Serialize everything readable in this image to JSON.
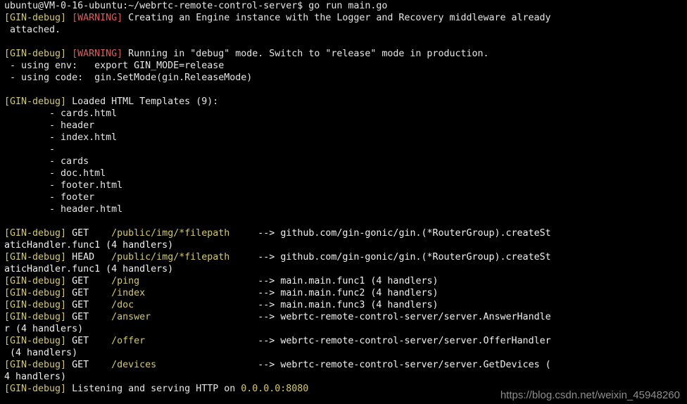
{
  "terminal": {
    "colors": {
      "background": "#000000",
      "foreground": "#e6e6e6",
      "debug_tag": "#d4c96a",
      "warning_tag": "#e05c5c",
      "route_path": "#d4c96a",
      "watermark": "#8e8e8e"
    },
    "prompt": {
      "user_host": "ubuntu@VM-0-16-ubuntu",
      "separator": ":",
      "cwd": "~/webrtc-remote-control-server",
      "symbol": "$",
      "command": "go run main.go",
      "full": "ubuntu@VM-0-16-ubuntu:~/webrtc-remote-control-server$ go run main.go"
    },
    "lines": [
      {
        "id": "prompt-line",
        "segments": [
          {
            "cls": "seg-prompt",
            "text": "ubuntu@VM-0-16-ubuntu:~/webrtc-remote-control-server$ go run main.go"
          }
        ]
      },
      {
        "id": "warn-engine-1",
        "segments": [
          {
            "cls": "seg-debug",
            "text": "[GIN-debug] "
          },
          {
            "cls": "seg-warning",
            "text": "[WARNING] "
          },
          {
            "cls": "seg-plain",
            "text": "Creating an Engine instance with the Logger and Recovery middleware already"
          }
        ]
      },
      {
        "id": "warn-engine-2",
        "segments": [
          {
            "cls": "seg-plain",
            "text": " attached."
          }
        ]
      },
      {
        "id": "spacer-1",
        "segments": [
          {
            "cls": "seg-plain",
            "text": " "
          }
        ]
      },
      {
        "id": "warn-mode-1",
        "segments": [
          {
            "cls": "seg-debug",
            "text": "[GIN-debug] "
          },
          {
            "cls": "seg-warning",
            "text": "[WARNING] "
          },
          {
            "cls": "seg-plain",
            "text": "Running in \"debug\" mode. Switch to \"release\" mode in production."
          }
        ]
      },
      {
        "id": "warn-mode-env",
        "segments": [
          {
            "cls": "seg-plain",
            "text": " - using env:   export GIN_MODE=release"
          }
        ]
      },
      {
        "id": "warn-mode-code",
        "segments": [
          {
            "cls": "seg-plain",
            "text": " - using code:  gin.SetMode(gin.ReleaseMode)"
          }
        ]
      },
      {
        "id": "spacer-2",
        "segments": [
          {
            "cls": "seg-plain",
            "text": " "
          }
        ]
      },
      {
        "id": "templates-header",
        "segments": [
          {
            "cls": "seg-debug",
            "text": "[GIN-debug] "
          },
          {
            "cls": "seg-plain",
            "text": "Loaded HTML Templates (9):"
          }
        ]
      },
      {
        "id": "template-cards-html",
        "segments": [
          {
            "cls": "seg-plain",
            "text": "        - cards.html"
          }
        ]
      },
      {
        "id": "template-header",
        "segments": [
          {
            "cls": "seg-plain",
            "text": "        - header"
          }
        ]
      },
      {
        "id": "template-index-html",
        "segments": [
          {
            "cls": "seg-plain",
            "text": "        - index.html"
          }
        ]
      },
      {
        "id": "template-empty",
        "segments": [
          {
            "cls": "seg-plain",
            "text": "        - "
          }
        ]
      },
      {
        "id": "template-cards",
        "segments": [
          {
            "cls": "seg-plain",
            "text": "        - cards"
          }
        ]
      },
      {
        "id": "template-doc-html",
        "segments": [
          {
            "cls": "seg-plain",
            "text": "        - doc.html"
          }
        ]
      },
      {
        "id": "template-footer-html",
        "segments": [
          {
            "cls": "seg-plain",
            "text": "        - footer.html"
          }
        ]
      },
      {
        "id": "template-footer",
        "segments": [
          {
            "cls": "seg-plain",
            "text": "        - footer"
          }
        ]
      },
      {
        "id": "template-header-html",
        "segments": [
          {
            "cls": "seg-plain",
            "text": "        - header.html"
          }
        ]
      },
      {
        "id": "spacer-3",
        "segments": [
          {
            "cls": "seg-plain",
            "text": " "
          }
        ]
      },
      {
        "id": "route-img-get-1",
        "segments": [
          {
            "cls": "seg-debug",
            "text": "[GIN-debug] "
          },
          {
            "cls": "seg-method",
            "text": "GET "
          },
          {
            "cls": "seg-plain",
            "text": "   "
          },
          {
            "cls": "seg-path",
            "text": "/public/img/*filepath"
          },
          {
            "cls": "seg-plain",
            "text": "     "
          },
          {
            "cls": "seg-arrow",
            "text": "--> "
          },
          {
            "cls": "seg-handler",
            "text": "github.com/gin-gonic/gin.(*RouterGroup).createSt"
          }
        ]
      },
      {
        "id": "route-img-get-2",
        "segments": [
          {
            "cls": "seg-handler",
            "text": "aticHandler.func1 (4 handlers)"
          }
        ]
      },
      {
        "id": "route-img-head-1",
        "segments": [
          {
            "cls": "seg-debug",
            "text": "[GIN-debug] "
          },
          {
            "cls": "seg-method",
            "text": "HEAD"
          },
          {
            "cls": "seg-plain",
            "text": "   "
          },
          {
            "cls": "seg-path",
            "text": "/public/img/*filepath"
          },
          {
            "cls": "seg-plain",
            "text": "     "
          },
          {
            "cls": "seg-arrow",
            "text": "--> "
          },
          {
            "cls": "seg-handler",
            "text": "github.com/gin-gonic/gin.(*RouterGroup).createSt"
          }
        ]
      },
      {
        "id": "route-img-head-2",
        "segments": [
          {
            "cls": "seg-handler",
            "text": "aticHandler.func1 (4 handlers)"
          }
        ]
      },
      {
        "id": "route-ping",
        "segments": [
          {
            "cls": "seg-debug",
            "text": "[GIN-debug] "
          },
          {
            "cls": "seg-method",
            "text": "GET "
          },
          {
            "cls": "seg-plain",
            "text": "   "
          },
          {
            "cls": "seg-path",
            "text": "/ping"
          },
          {
            "cls": "seg-plain",
            "text": "                     "
          },
          {
            "cls": "seg-arrow",
            "text": "--> "
          },
          {
            "cls": "seg-handler",
            "text": "main.main.func1 (4 handlers)"
          }
        ]
      },
      {
        "id": "route-index",
        "segments": [
          {
            "cls": "seg-debug",
            "text": "[GIN-debug] "
          },
          {
            "cls": "seg-method",
            "text": "GET "
          },
          {
            "cls": "seg-plain",
            "text": "   "
          },
          {
            "cls": "seg-path",
            "text": "/index"
          },
          {
            "cls": "seg-plain",
            "text": "                    "
          },
          {
            "cls": "seg-arrow",
            "text": "--> "
          },
          {
            "cls": "seg-handler",
            "text": "main.main.func2 (4 handlers)"
          }
        ]
      },
      {
        "id": "route-doc",
        "segments": [
          {
            "cls": "seg-debug",
            "text": "[GIN-debug] "
          },
          {
            "cls": "seg-method",
            "text": "GET "
          },
          {
            "cls": "seg-plain",
            "text": "   "
          },
          {
            "cls": "seg-path",
            "text": "/doc"
          },
          {
            "cls": "seg-plain",
            "text": "                      "
          },
          {
            "cls": "seg-arrow",
            "text": "--> "
          },
          {
            "cls": "seg-handler",
            "text": "main.main.func3 (4 handlers)"
          }
        ]
      },
      {
        "id": "route-answer-1",
        "segments": [
          {
            "cls": "seg-debug",
            "text": "[GIN-debug] "
          },
          {
            "cls": "seg-method",
            "text": "GET "
          },
          {
            "cls": "seg-plain",
            "text": "   "
          },
          {
            "cls": "seg-path",
            "text": "/answer"
          },
          {
            "cls": "seg-plain",
            "text": "                   "
          },
          {
            "cls": "seg-arrow",
            "text": "--> "
          },
          {
            "cls": "seg-handler",
            "text": "webrtc-remote-control-server/server.AnswerHandle"
          }
        ]
      },
      {
        "id": "route-answer-2",
        "segments": [
          {
            "cls": "seg-handler",
            "text": "r (4 handlers)"
          }
        ]
      },
      {
        "id": "route-offer-1",
        "segments": [
          {
            "cls": "seg-debug",
            "text": "[GIN-debug] "
          },
          {
            "cls": "seg-method",
            "text": "GET "
          },
          {
            "cls": "seg-plain",
            "text": "   "
          },
          {
            "cls": "seg-path",
            "text": "/offer"
          },
          {
            "cls": "seg-plain",
            "text": "                    "
          },
          {
            "cls": "seg-arrow",
            "text": "--> "
          },
          {
            "cls": "seg-handler",
            "text": "webrtc-remote-control-server/server.OfferHandler"
          }
        ]
      },
      {
        "id": "route-offer-2",
        "segments": [
          {
            "cls": "seg-handler",
            "text": " (4 handlers)"
          }
        ]
      },
      {
        "id": "route-devices-1",
        "segments": [
          {
            "cls": "seg-debug",
            "text": "[GIN-debug] "
          },
          {
            "cls": "seg-method",
            "text": "GET "
          },
          {
            "cls": "seg-plain",
            "text": "   "
          },
          {
            "cls": "seg-path",
            "text": "/devices"
          },
          {
            "cls": "seg-plain",
            "text": "                  "
          },
          {
            "cls": "seg-arrow",
            "text": "--> "
          },
          {
            "cls": "seg-handler",
            "text": "webrtc-remote-control-server/server.GetDevices ("
          }
        ]
      },
      {
        "id": "route-devices-2",
        "segments": [
          {
            "cls": "seg-handler",
            "text": "4 handlers)"
          }
        ]
      },
      {
        "id": "listening-line",
        "segments": [
          {
            "cls": "seg-debug",
            "text": "[GIN-debug] "
          },
          {
            "cls": "seg-plain",
            "text": "Listening and serving HTTP on "
          },
          {
            "cls": "seg-addr",
            "text": "0.0.0.0:8080"
          }
        ]
      }
    ],
    "routes": [
      {
        "method": "GET",
        "path": "/public/img/*filepath",
        "handler": "github.com/gin-gonic/gin.(*RouterGroup).createStaticHandler.func1",
        "handler_count": "4 handlers"
      },
      {
        "method": "HEAD",
        "path": "/public/img/*filepath",
        "handler": "github.com/gin-gonic/gin.(*RouterGroup).createStaticHandler.func1",
        "handler_count": "4 handlers"
      },
      {
        "method": "GET",
        "path": "/ping",
        "handler": "main.main.func1",
        "handler_count": "4 handlers"
      },
      {
        "method": "GET",
        "path": "/index",
        "handler": "main.main.func2",
        "handler_count": "4 handlers"
      },
      {
        "method": "GET",
        "path": "/doc",
        "handler": "main.main.func3",
        "handler_count": "4 handlers"
      },
      {
        "method": "GET",
        "path": "/answer",
        "handler": "webrtc-remote-control-server/server.AnswerHandler",
        "handler_count": "4 handlers"
      },
      {
        "method": "GET",
        "path": "/offer",
        "handler": "webrtc-remote-control-server/server.OfferHandler",
        "handler_count": "4 handlers"
      },
      {
        "method": "GET",
        "path": "/devices",
        "handler": "webrtc-remote-control-server/server.GetDevices",
        "handler_count": "4 handlers"
      }
    ],
    "templates": {
      "count": "9",
      "header_text": "Loaded HTML Templates (9):",
      "items": [
        "cards.html",
        "header",
        "index.html",
        "",
        "cards",
        "doc.html",
        "footer.html",
        "footer",
        "header.html"
      ]
    },
    "listen_address": "0.0.0.0:8080"
  },
  "watermark": {
    "text": "https://blog.csdn.net/weixin_45948260"
  }
}
